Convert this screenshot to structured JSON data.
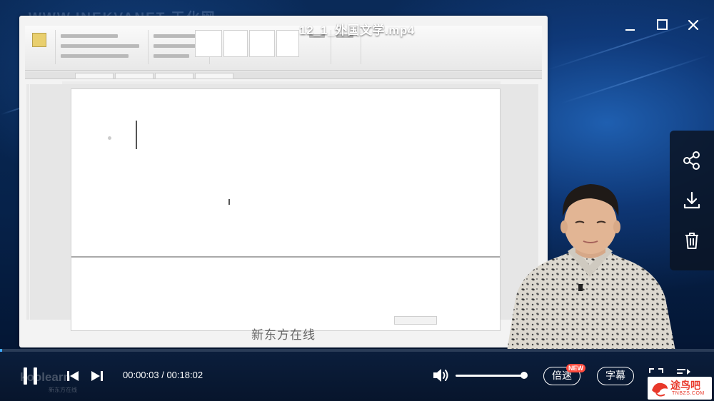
{
  "window": {
    "title": "12_1_外国文学.mp4"
  },
  "video": {
    "watermark": "WWW.INEKVANET 天化网",
    "brand_caption": "新东方在线"
  },
  "side_panel": {
    "items": [
      {
        "icon": "share-icon"
      },
      {
        "icon": "download-icon"
      },
      {
        "icon": "trash-icon"
      }
    ]
  },
  "controls": {
    "current_time": "00:00:03",
    "total_time": "00:18:02",
    "time_separator": " / ",
    "speed_label": "倍速",
    "speed_badge": "NEW",
    "subtitle_label": "字幕",
    "progress": 0.003,
    "volume": 1.0,
    "logo_ghost": "koolearn",
    "logo_ghost_sub": "新东方在线"
  },
  "site_logo": {
    "name": "途鸟吧",
    "domain": "TNBZS.COM"
  },
  "colors": {
    "accent": "#3fa9ff",
    "badge": "#ff4a3d",
    "bar_bg": "#07152c"
  }
}
